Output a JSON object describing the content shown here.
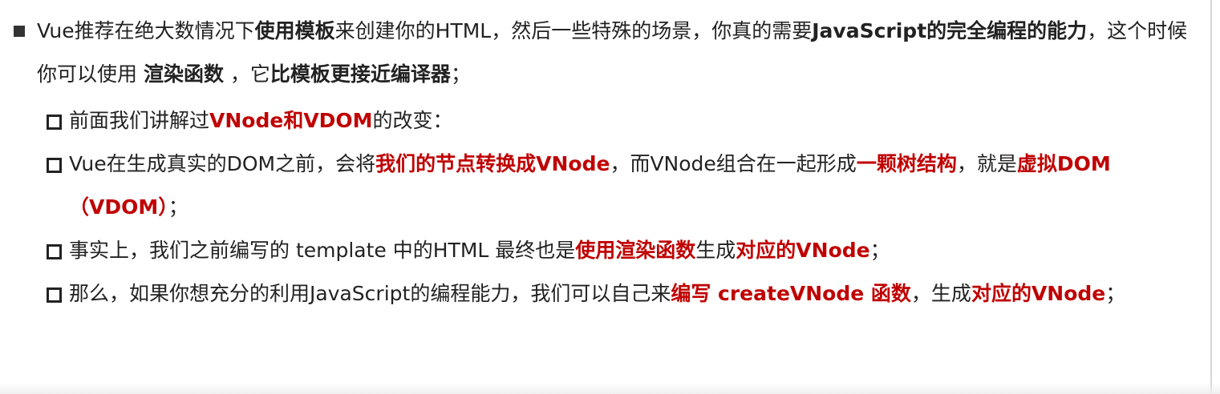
{
  "main_point": {
    "segments": [
      {
        "text": "Vue推荐在绝大数情况下",
        "style": "n"
      },
      {
        "text": "使用模板",
        "style": "b"
      },
      {
        "text": "来创建你的HTML，然后一些特殊的场景，你真的需要",
        "style": "n"
      },
      {
        "text": "JavaScript的完全编程的能力",
        "style": "b"
      },
      {
        "text": "，这个时候你可以使用 ",
        "style": "n"
      },
      {
        "text": "渲染函数",
        "style": "b"
      },
      {
        "text": " ，它",
        "style": "n"
      },
      {
        "text": "比模板更接近编译器",
        "style": "b"
      },
      {
        "text": "；",
        "style": "n"
      }
    ]
  },
  "sub_points": [
    {
      "segments": [
        {
          "text": "前面我们讲解过",
          "style": "n"
        },
        {
          "text": "VNode和VDOM",
          "style": "r"
        },
        {
          "text": "的改变：",
          "style": "n"
        }
      ]
    },
    {
      "segments": [
        {
          "text": "Vue在生成真实的DOM之前，会将",
          "style": "n"
        },
        {
          "text": "我们的节点转换成VNode",
          "style": "r"
        },
        {
          "text": "，而VNode组合在一起形成",
          "style": "n"
        },
        {
          "text": "一颗树结构",
          "style": "r"
        },
        {
          "text": "，就是",
          "style": "n"
        },
        {
          "text": "虚拟DOM（VDOM）",
          "style": "r"
        },
        {
          "text": "；",
          "style": "n"
        }
      ]
    },
    {
      "segments": [
        {
          "text": "事实上，我们之前编写的 template 中的HTML 最终也是",
          "style": "n"
        },
        {
          "text": "使用渲染函数",
          "style": "r"
        },
        {
          "text": "生成",
          "style": "n"
        },
        {
          "text": "对应的VNode",
          "style": "r"
        },
        {
          "text": "；",
          "style": "n"
        }
      ]
    },
    {
      "segments": [
        {
          "text": "那么，如果你想充分的利用JavaScript的编程能力，我们可以自己来",
          "style": "n"
        },
        {
          "text": "编写 createVNode 函数",
          "style": "r"
        },
        {
          "text": "，生成",
          "style": "n"
        },
        {
          "text": "对应的VNode",
          "style": "r"
        },
        {
          "text": "；",
          "style": "n"
        }
      ]
    }
  ]
}
